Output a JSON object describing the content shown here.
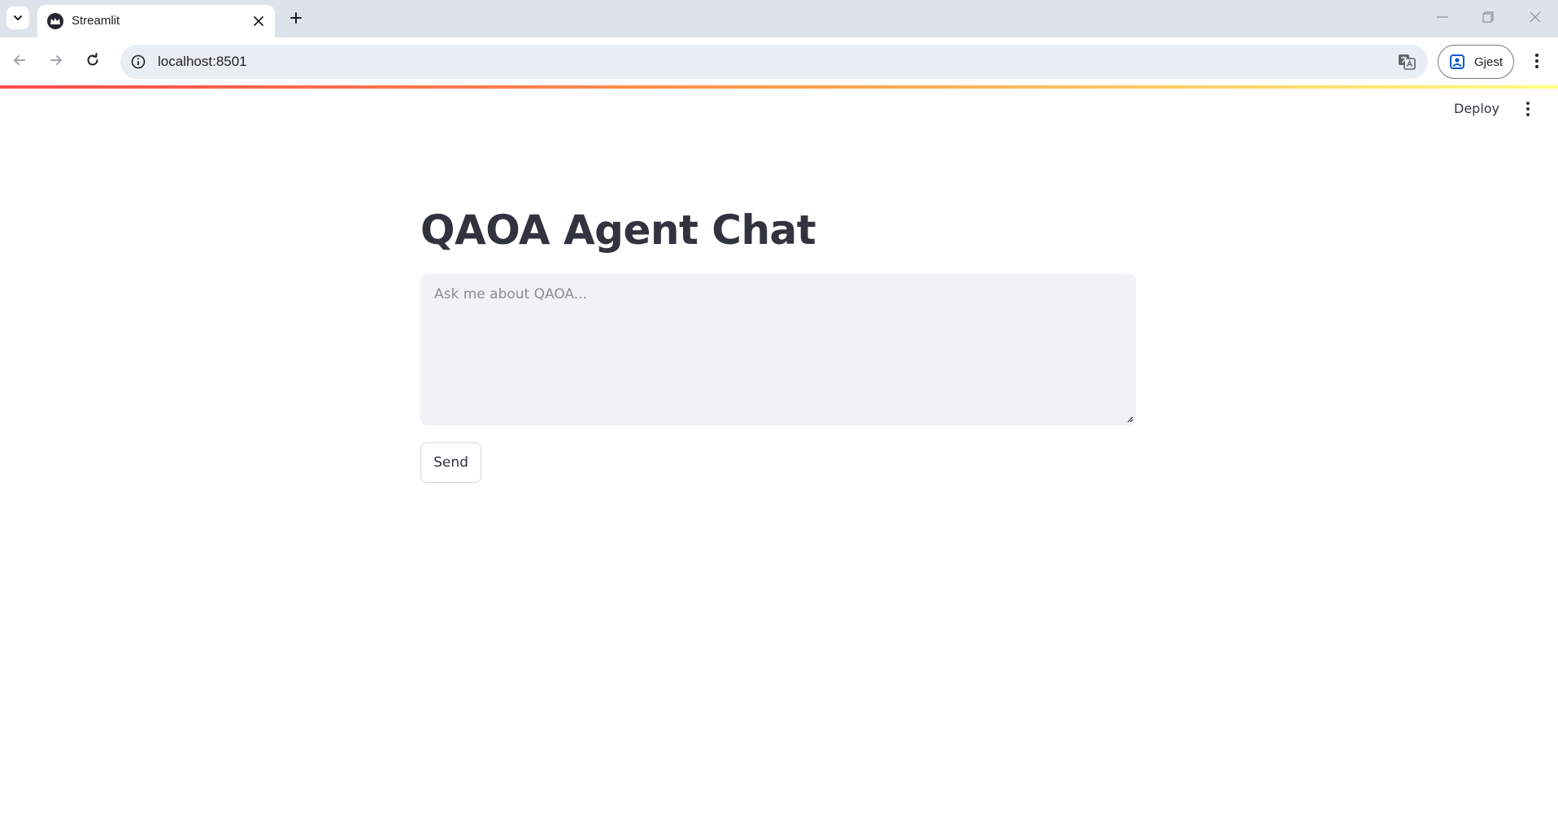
{
  "browser": {
    "tab": {
      "title": "Streamlit"
    },
    "address_bar": {
      "url": "localhost:8501"
    },
    "profile": {
      "label": "Gjest"
    }
  },
  "app": {
    "header": {
      "deploy_label": "Deploy"
    },
    "title": "QAOA Agent Chat",
    "chat_input": {
      "placeholder": "Ask me about QAOA...",
      "value": ""
    },
    "send_label": "Send"
  },
  "colors": {
    "text": "#31333f",
    "input_background": "#f0f2f6",
    "decoration_start": "#ff4b4b",
    "decoration_end": "#fffd80"
  }
}
